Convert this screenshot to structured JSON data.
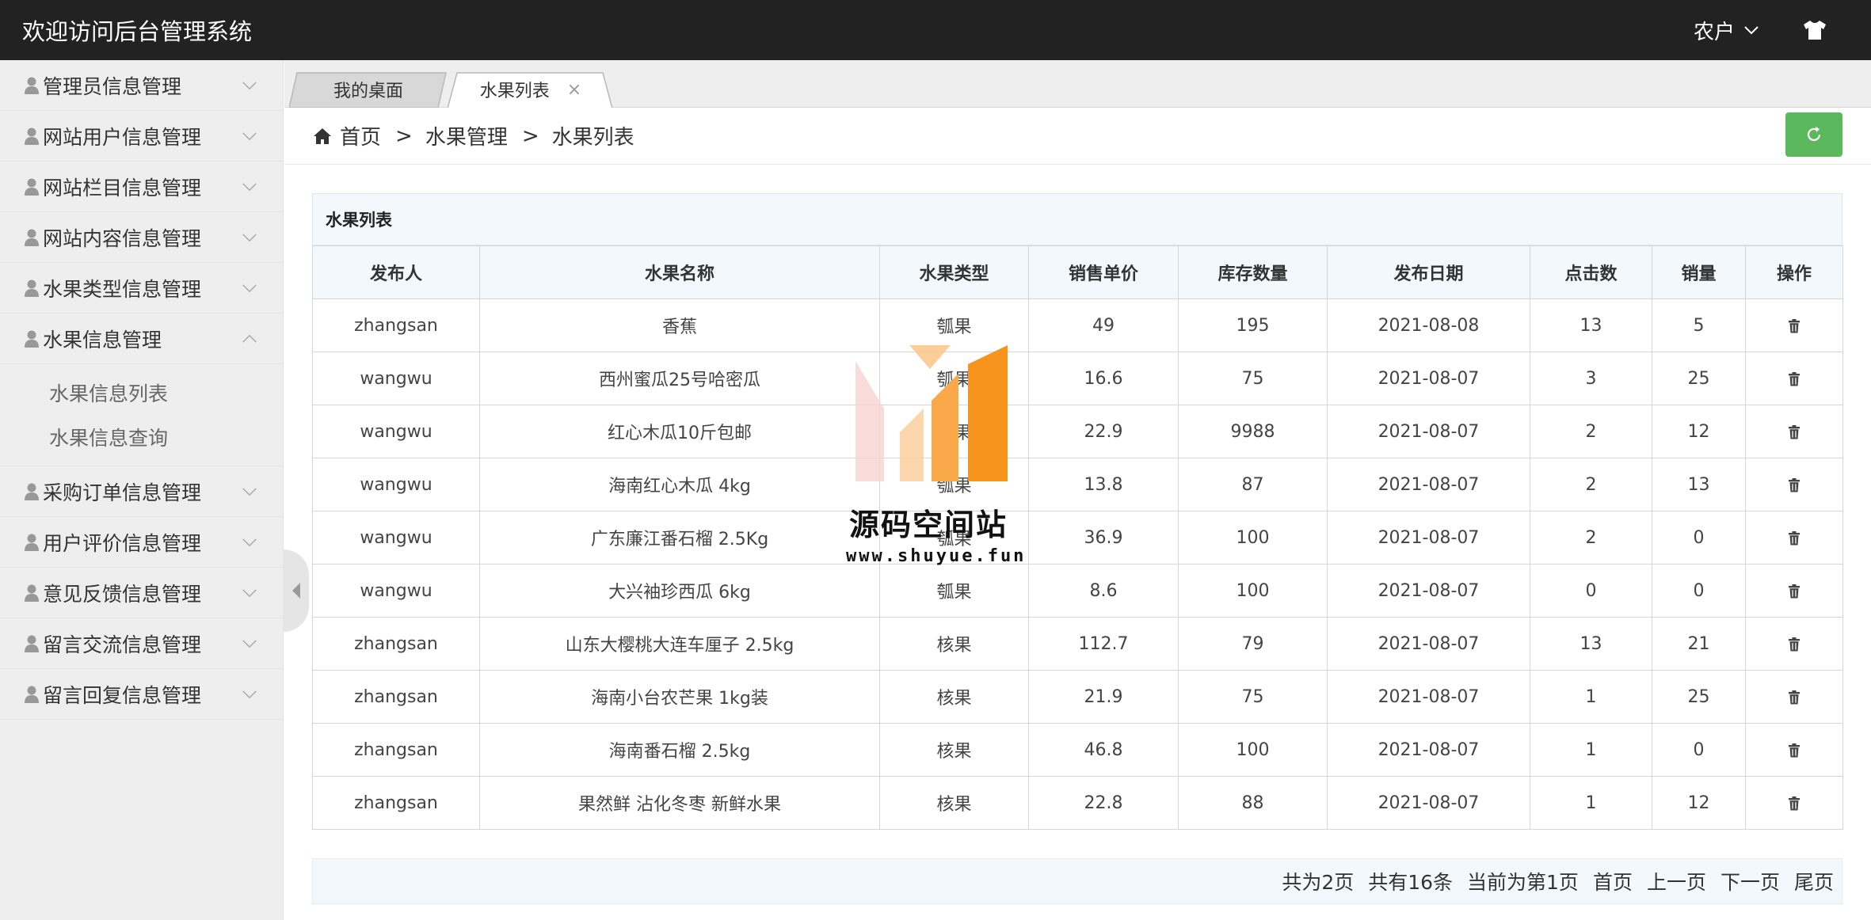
{
  "header": {
    "title": "欢迎访问后台管理系统",
    "user": "农户"
  },
  "sidebar": {
    "items": [
      {
        "label": "管理员信息管理"
      },
      {
        "label": "网站用户信息管理"
      },
      {
        "label": "网站栏目信息管理"
      },
      {
        "label": "网站内容信息管理"
      },
      {
        "label": "水果类型信息管理"
      },
      {
        "label": "水果信息管理",
        "expanded": true,
        "children": [
          {
            "label": "水果信息列表"
          },
          {
            "label": "水果信息查询"
          }
        ]
      },
      {
        "label": "采购订单信息管理"
      },
      {
        "label": "用户评价信息管理"
      },
      {
        "label": "意见反馈信息管理"
      },
      {
        "label": "留言交流信息管理"
      },
      {
        "label": "留言回复信息管理"
      }
    ]
  },
  "tabs": [
    {
      "label": "我的桌面"
    },
    {
      "label": "水果列表",
      "active": true,
      "close": "×"
    }
  ],
  "breadcrumb": {
    "home": "首页",
    "sep": ">",
    "level1": "水果管理",
    "level2": "水果列表"
  },
  "table": {
    "title": "水果列表",
    "columns": [
      "发布人",
      "水果名称",
      "水果类型",
      "销售单价",
      "库存数量",
      "发布日期",
      "点击数",
      "销量",
      "操作"
    ],
    "rows": [
      [
        "zhangsan",
        "香蕉",
        "瓠果",
        "49",
        "195",
        "2021-08-08",
        "13",
        "5"
      ],
      [
        "wangwu",
        "西州蜜瓜25号哈密瓜",
        "瓠果",
        "16.6",
        "75",
        "2021-08-07",
        "3",
        "25"
      ],
      [
        "wangwu",
        "红心木瓜10斤包邮",
        "瓠果",
        "22.9",
        "9988",
        "2021-08-07",
        "2",
        "12"
      ],
      [
        "wangwu",
        "海南红心木瓜 4kg",
        "瓠果",
        "13.8",
        "87",
        "2021-08-07",
        "2",
        "13"
      ],
      [
        "wangwu",
        "广东廉江番石榴 2.5Kg",
        "瓠果",
        "36.9",
        "100",
        "2021-08-07",
        "2",
        "0"
      ],
      [
        "wangwu",
        "大兴袖珍西瓜 6kg",
        "瓠果",
        "8.6",
        "100",
        "2021-08-07",
        "0",
        "0"
      ],
      [
        "zhangsan",
        "山东大樱桃大连车厘子 2.5kg",
        "核果",
        "112.7",
        "79",
        "2021-08-07",
        "13",
        "21"
      ],
      [
        "zhangsan",
        "海南小台农芒果 1kg装",
        "核果",
        "21.9",
        "75",
        "2021-08-07",
        "1",
        "25"
      ],
      [
        "zhangsan",
        "海南番石榴 2.5kg",
        "核果",
        "46.8",
        "100",
        "2021-08-07",
        "1",
        "0"
      ],
      [
        "zhangsan",
        "果然鲜 沾化冬枣 新鲜水果",
        "核果",
        "22.8",
        "88",
        "2021-08-07",
        "1",
        "12"
      ]
    ]
  },
  "pager": {
    "total_pages": "共为2页",
    "total_items": "共有16条",
    "current": "当前为第1页",
    "first": "首页",
    "prev": "上一页",
    "next": "下一页",
    "last": "尾页"
  },
  "watermark": {
    "title": "源码空间站",
    "url": "www.shuyue.fun"
  },
  "colors": {
    "header_bg": "#222222",
    "refresh_btn": "#5cb85c",
    "table_head_bg": "#f3f8fd",
    "watermark_orange": "#f7941d"
  }
}
